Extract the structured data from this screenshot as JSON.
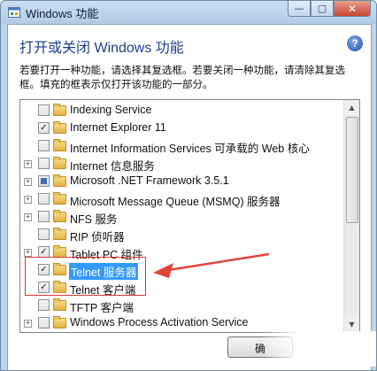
{
  "window": {
    "title": "Windows 功能",
    "icon": "windows-features-icon"
  },
  "caption": {
    "minimize": "—",
    "maximize": "▢",
    "close": "✕"
  },
  "header": {
    "title": "打开或关闭 Windows 功能",
    "help_icon": "?"
  },
  "description": {
    "line1": "若要打开一种功能，请选择其复选框。若要关闭一种功能，请清除其复选",
    "line2": "框。填充的框表示仅打开该功能的一部分。"
  },
  "features": [
    {
      "label": "Indexing Service",
      "state": "unchecked",
      "expandable": false
    },
    {
      "label": "Internet Explorer 11",
      "state": "checked",
      "expandable": false
    },
    {
      "label": "Internet Information Services 可承载的 Web 核心",
      "state": "unchecked",
      "expandable": false
    },
    {
      "label": "Internet 信息服务",
      "state": "unchecked",
      "expandable": true
    },
    {
      "label": "Microsoft .NET Framework 3.5.1",
      "state": "partial",
      "expandable": true
    },
    {
      "label": "Microsoft Message Queue (MSMQ) 服务器",
      "state": "unchecked",
      "expandable": true
    },
    {
      "label": "NFS 服务",
      "state": "unchecked",
      "expandable": true
    },
    {
      "label": "RIP 侦听器",
      "state": "unchecked",
      "expandable": false
    },
    {
      "label": "Tablet PC 组件",
      "state": "checked",
      "expandable": true
    },
    {
      "label": "Telnet 服务器",
      "state": "checked",
      "expandable": false,
      "selected": true
    },
    {
      "label": "Telnet 客户端",
      "state": "checked",
      "expandable": false
    },
    {
      "label": "TFTP 客户端",
      "state": "unchecked",
      "expandable": false
    },
    {
      "label": "Windows Process Activation Service",
      "state": "unchecked",
      "expandable": true
    }
  ],
  "glyphs": {
    "check": "✓",
    "expand": "+",
    "scroll_up": "▲",
    "scroll_down": "▼"
  },
  "buttons": {
    "ok": "确"
  },
  "colors": {
    "selection": "#3399ff",
    "annotation": "#d93a3a",
    "title_blue": "#1e3f8a"
  }
}
